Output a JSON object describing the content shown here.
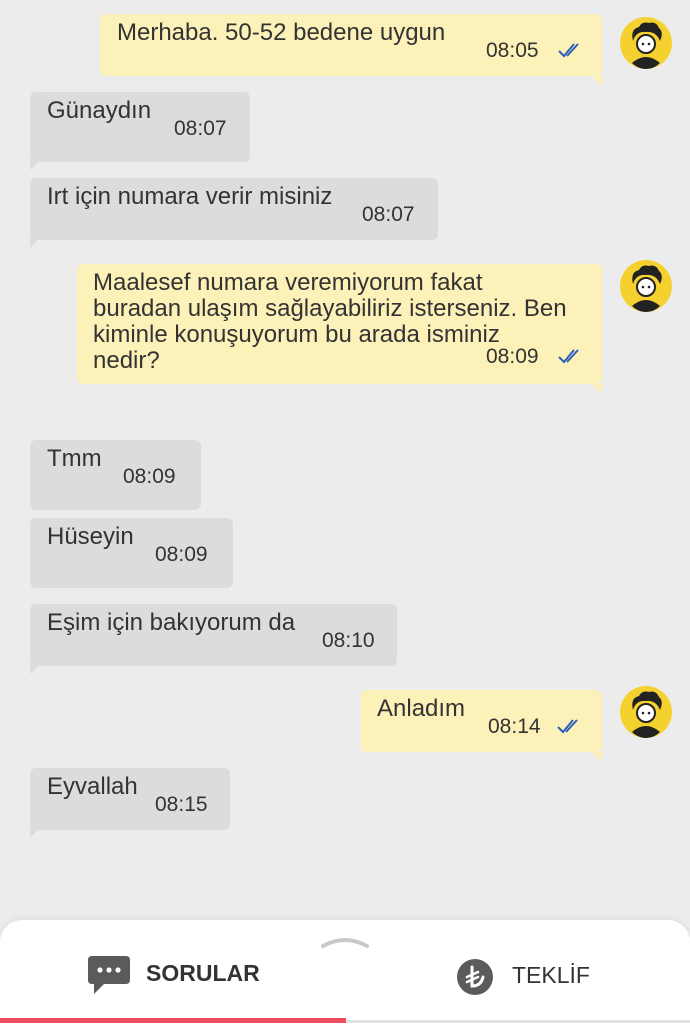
{
  "messages": [
    {
      "side": "out",
      "text": "Merhaba. 50-52 bedene uygun",
      "time": "08:05",
      "read": true
    },
    {
      "side": "in",
      "text": "Günaydın",
      "time": "08:07"
    },
    {
      "side": "in",
      "text": "Irt için numara verir misiniz",
      "time": "08:07"
    },
    {
      "side": "out",
      "lines": [
        "Maalesef numara veremiyorum fakat",
        "buradan ulaşım sağlayabiliriz isterseniz. Ben",
        "kiminle konuşuyorum bu arada isminiz",
        "nedir?"
      ],
      "time": "08:09",
      "read": true
    },
    {
      "side": "in",
      "text": "Tmm",
      "time": "08:09"
    },
    {
      "side": "in",
      "text": "Hüseyin",
      "time": "08:09"
    },
    {
      "side": "in",
      "text": "Eşim için bakıyorum da",
      "time": "08:10"
    },
    {
      "side": "out",
      "text": "Anladım",
      "time": "08:14",
      "read": true
    },
    {
      "side": "in",
      "text": "Eyvallah",
      "time": "08:15"
    }
  ],
  "tabs": {
    "questions": {
      "label": "SORULAR",
      "icon": "chat-bubble-icon",
      "active": true
    },
    "offer": {
      "label": "TEKLİF",
      "icon": "lira-coin-icon",
      "active": false
    }
  },
  "colors": {
    "incoming_bubble": "#dcdcdc",
    "outgoing_bubble": "#fcf1b9",
    "read_ticks": "#2c5fb8",
    "avatar_bg": "#f5d130",
    "active_tab_underline": "#f04e5f"
  }
}
